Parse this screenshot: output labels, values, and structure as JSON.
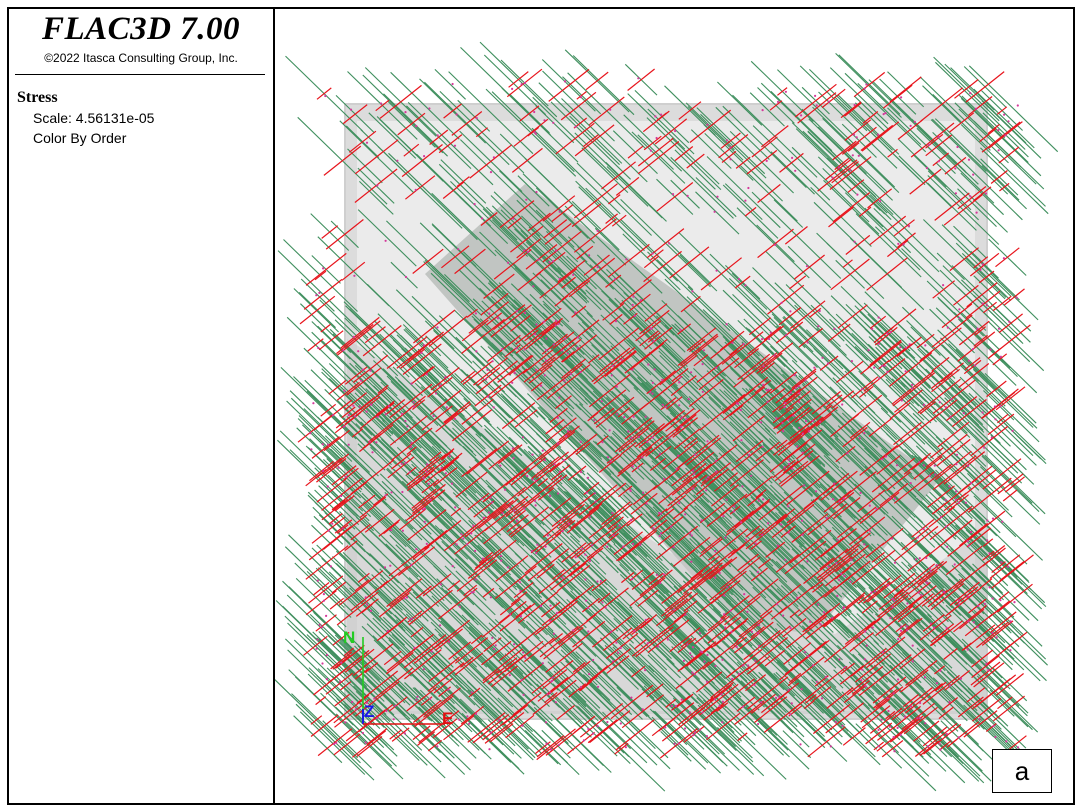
{
  "app": {
    "title": "FLAC3D 7.00",
    "copyright": "©2022 Itasca Consulting Group, Inc."
  },
  "legend": {
    "heading": "Stress",
    "scale_text": "Scale: 4.56131e-05",
    "color_text": "Color By Order"
  },
  "axes": {
    "north_label": "N",
    "up_label": "Z",
    "east_label": "E",
    "north_color": "#22cc22",
    "up_color": "#1a1ae6",
    "east_color": "#e01010"
  },
  "colors": {
    "stress_major": "#3f8f5e",
    "stress_minor": "#e8141c",
    "stress_intermediate": "#d4399a",
    "block_fill": "#e2e2e2",
    "slab_fill": "#b9bebb"
  },
  "panel_label": "a"
}
